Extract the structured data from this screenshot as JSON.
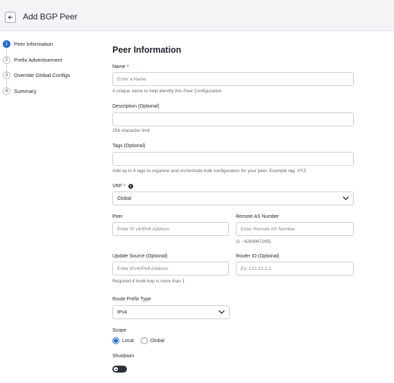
{
  "header": {
    "title": "Add BGP Peer",
    "back_icon": "arrow-left-icon"
  },
  "steps": [
    {
      "number": "1",
      "label": "Peer Information",
      "active": true
    },
    {
      "number": "2",
      "label": "Prefix Advertisement",
      "active": false
    },
    {
      "number": "3",
      "label": "Override Global Configs",
      "active": false
    },
    {
      "number": "4",
      "label": "Summary",
      "active": false
    }
  ],
  "form": {
    "title": "Peer Information",
    "name": {
      "label": "Name",
      "required_mark": "*",
      "placeholder": "Enter a Name",
      "help": "A unique name to help identify this Peer Configuration."
    },
    "description": {
      "label": "Description (Optional)",
      "placeholder": "",
      "help": "256 character limit"
    },
    "tags": {
      "label": "Tags (Optional)",
      "placeholder": "",
      "help": "Add up to 4 tags to organise and orchestrate bulk configuration for your peer. Example tag: XYZ"
    },
    "vrf": {
      "label": "VRF",
      "required_mark": "*",
      "info_icon": "info-icon",
      "value": "Global"
    },
    "peer": {
      "label": "Peer",
      "placeholder": "Enter IP v4/IPv6 Address"
    },
    "remote_as": {
      "label": "Remote AS Number",
      "placeholder": "Enter Remote AS Number",
      "help": "(1 - 4294967295)"
    },
    "update_source": {
      "label": "Update Source (Optional)",
      "placeholder": "Enter IPv4/IPv6 Address",
      "help": "Required if multi-hop is more than 1"
    },
    "router_id": {
      "label": "Router ID (Optional)",
      "placeholder": "Ex: 122.22.2.2"
    },
    "route_prefix_type": {
      "label": "Route Prefix Type",
      "value": "IPv4"
    },
    "scope": {
      "label": "Scope",
      "options": [
        "Local",
        "Global"
      ],
      "selected": "Local"
    },
    "shutdown": {
      "label": "Shutdown",
      "on": false
    }
  },
  "colors": {
    "accent": "#1d6bd8",
    "required": "#d93025"
  }
}
